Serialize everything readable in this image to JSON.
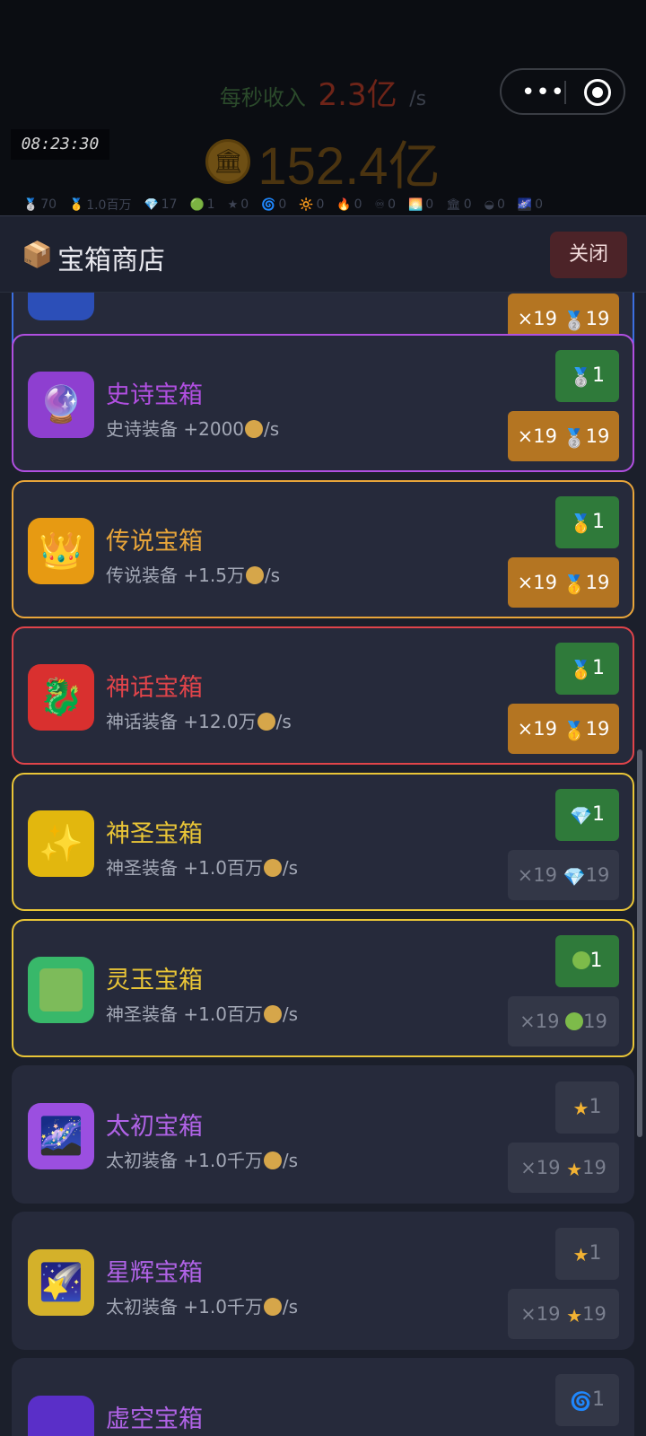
{
  "hud": {
    "rate_label": "每秒收入",
    "rate_value": "2.3亿",
    "rate_unit": "/s",
    "balance": "152.4亿",
    "time": "08:23:30",
    "stats": [
      {
        "icon": "silver-medal",
        "glyph": "🥈",
        "value": "70"
      },
      {
        "icon": "gold-medal",
        "glyph": "🥇",
        "value": "1.0百万"
      },
      {
        "icon": "gem",
        "glyph": "💎",
        "value": "17"
      },
      {
        "icon": "green-orb",
        "glyph": "🟢",
        "value": "1"
      },
      {
        "icon": "star",
        "glyph": "★",
        "value": "0"
      },
      {
        "icon": "swirl",
        "glyph": "🌀",
        "value": "0"
      },
      {
        "icon": "sun",
        "glyph": "🔆",
        "value": "0"
      },
      {
        "icon": "fire",
        "glyph": "🔥",
        "value": "0"
      },
      {
        "icon": "infinity",
        "glyph": "♾",
        "value": "0"
      },
      {
        "icon": "sunset",
        "glyph": "🌅",
        "value": "0"
      },
      {
        "icon": "temple",
        "glyph": "🏛",
        "value": "0"
      },
      {
        "icon": "eye",
        "glyph": "◒",
        "value": "0"
      },
      {
        "icon": "galaxy",
        "glyph": "🌌",
        "value": "0"
      }
    ]
  },
  "panel": {
    "title": "宝箱商店",
    "close_label": "关闭"
  },
  "cards": [
    {
      "name": "",
      "desc": "",
      "desc_suffix": "",
      "color": "#3b6fe0",
      "icon_bg": "#2c4fb8",
      "icon_glyph": "",
      "icon_name": "blue-box-icon",
      "one_glyph": "🥈",
      "one_count": "",
      "ten_mult": "×19",
      "ten_glyph": "🥈",
      "ten_count": "19",
      "one_enabled": true,
      "ten_enabled": true
    },
    {
      "name": "史诗宝箱",
      "desc": "史诗装备 +2000",
      "desc_suffix": "/s",
      "color": "#b04fe0",
      "icon_bg": "#8e3fd0",
      "icon_glyph": "🔮",
      "icon_name": "crystal-ball-icon",
      "one_glyph": "🥈",
      "one_count": "1",
      "ten_mult": "×19",
      "ten_glyph": "🥈",
      "ten_count": "19",
      "one_enabled": true,
      "ten_enabled": true
    },
    {
      "name": "传说宝箱",
      "desc": "传说装备 +1.5万",
      "desc_suffix": "/s",
      "color": "#e8a53a",
      "icon_bg": "#e79a12",
      "icon_glyph": "👑",
      "icon_name": "crown-icon",
      "one_glyph": "🥇",
      "one_count": "1",
      "ten_mult": "×19",
      "ten_glyph": "🥇",
      "ten_count": "19",
      "one_enabled": true,
      "ten_enabled": true
    },
    {
      "name": "神话宝箱",
      "desc": "神话装备 +12.0万",
      "desc_suffix": "/s",
      "color": "#e0444a",
      "icon_bg": "#d9302f",
      "icon_glyph": "🐉",
      "icon_name": "dragon-icon",
      "one_glyph": "🥇",
      "one_count": "1",
      "ten_mult": "×19",
      "ten_glyph": "🥇",
      "ten_count": "19",
      "one_enabled": true,
      "ten_enabled": true
    },
    {
      "name": "神圣宝箱",
      "desc": "神圣装备 +1.0百万",
      "desc_suffix": "/s",
      "color": "#e9c537",
      "icon_bg": "#e2b70e",
      "icon_glyph": "✨",
      "icon_name": "sparkles-icon",
      "one_glyph": "💎",
      "one_count": "1",
      "ten_mult": "×19",
      "ten_glyph": "💎",
      "ten_count": "19",
      "one_enabled": true,
      "ten_enabled": false
    },
    {
      "name": "灵玉宝箱",
      "desc": "神圣装备 +1.0百万",
      "desc_suffix": "/s",
      "color": "#e9c537",
      "icon_bg": "#38b86a",
      "icon_glyph": "",
      "icon_name": "jade-icon",
      "one_glyph": "",
      "one_count": "1",
      "ten_mult": "×19",
      "ten_glyph": "",
      "ten_count": "19",
      "one_enabled": true,
      "ten_enabled": false
    },
    {
      "name": "太初宝箱",
      "desc": "太初装备 +1.0千万",
      "desc_suffix": "/s",
      "color": "#b063e6",
      "icon_bg": "#9b4fe0",
      "icon_glyph": "🌌",
      "icon_name": "milky-way-icon",
      "one_glyph": "★",
      "one_count": "1",
      "ten_mult": "×19",
      "ten_glyph": "★",
      "ten_count": "19",
      "one_enabled": false,
      "ten_enabled": false
    },
    {
      "name": "星辉宝箱",
      "desc": "太初装备 +1.0千万",
      "desc_suffix": "/s",
      "color": "#b063e6",
      "icon_bg": "#d4b12a",
      "icon_glyph": "🌠",
      "icon_name": "shooting-star-icon",
      "one_glyph": "★",
      "one_count": "1",
      "ten_mult": "×19",
      "ten_glyph": "★",
      "ten_count": "19",
      "one_enabled": false,
      "ten_enabled": false
    },
    {
      "name": "虚空宝箱",
      "desc": "",
      "desc_suffix": "",
      "color": "#b063e6",
      "icon_bg": "#5a2fc8",
      "icon_glyph": "",
      "icon_name": "void-icon",
      "one_glyph": "🌀",
      "one_count": "1",
      "ten_mult": "",
      "ten_glyph": "",
      "ten_count": "",
      "one_enabled": false,
      "ten_enabled": false
    }
  ]
}
